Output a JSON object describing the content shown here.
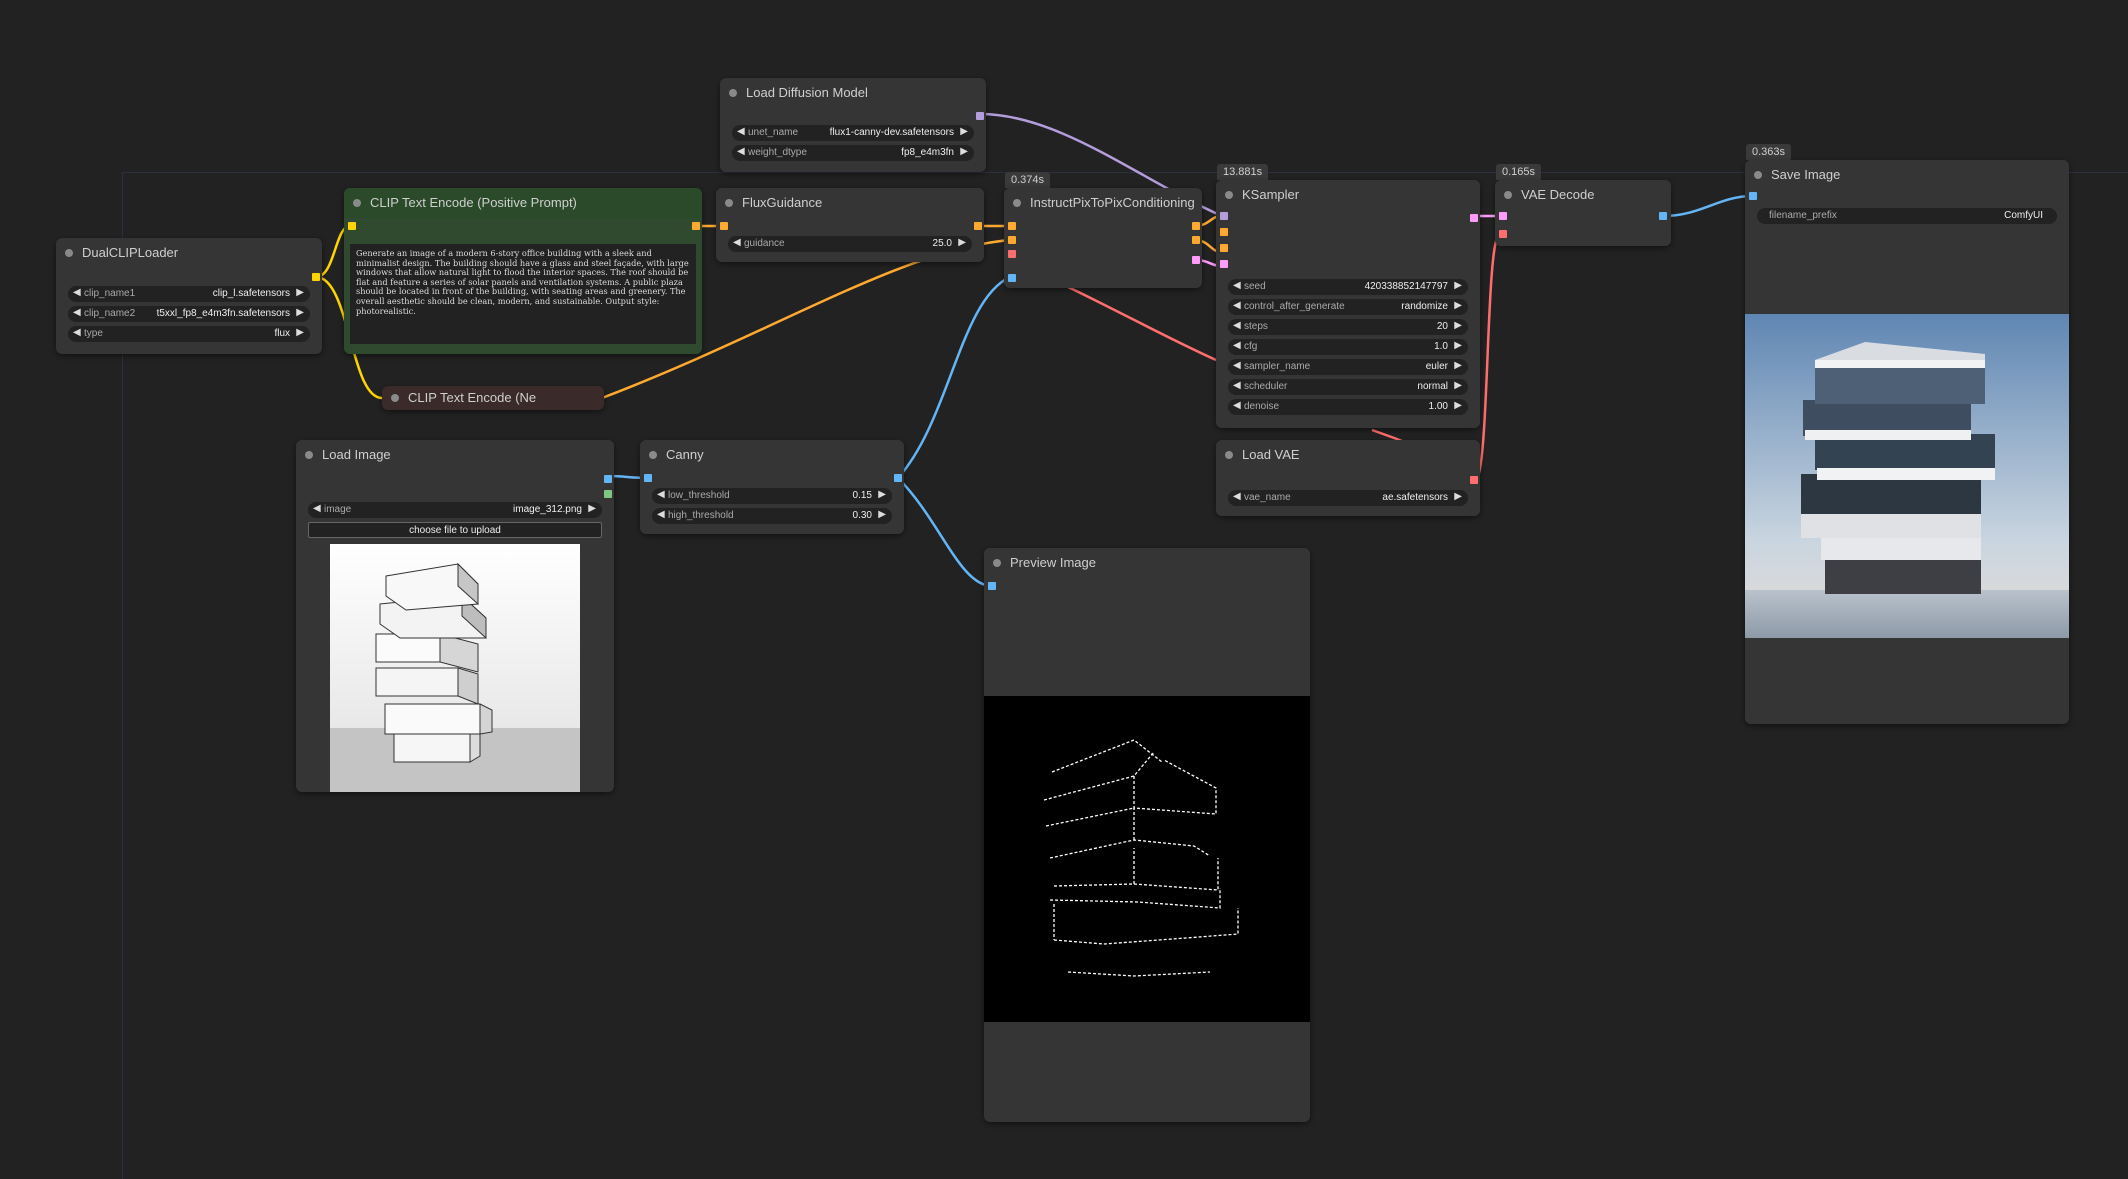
{
  "nodes": {
    "load_diffusion": {
      "title": "Load Diffusion Model",
      "widgets": [
        {
          "name": "unet_name",
          "value": "flux1-canny-dev.safetensors"
        },
        {
          "name": "weight_dtype",
          "value": "fp8_e4m3fn"
        }
      ]
    },
    "dual_clip": {
      "title": "DualCLIPLoader",
      "widgets": [
        {
          "name": "clip_name1",
          "value": "clip_l.safetensors"
        },
        {
          "name": "clip_name2",
          "value": "t5xxl_fp8_e4m3fn.safetensors"
        },
        {
          "name": "type",
          "value": "flux"
        }
      ]
    },
    "clip_pos": {
      "title": "CLIP Text Encode (Positive Prompt)",
      "prompt": "Generate an image of a modern 6-story office building with a sleek and minimalist design. The building should have a glass and steel façade, with large windows that allow natural light to flood the interior spaces. The roof should be flat and feature a series of solar panels and ventilation systems. A public plaza should be located in front of the building, with seating areas and greenery. The overall aesthetic should be clean, modern, and sustainable. Output style: photorealistic."
    },
    "clip_neg": {
      "title": "CLIP Text Encode (Ne"
    },
    "flux_guidance": {
      "title": "FluxGuidance",
      "widgets": [
        {
          "name": "guidance",
          "value": "25.0"
        }
      ]
    },
    "instruct_pix": {
      "title": "InstructPixToPixConditioning",
      "timing": "0.374s"
    },
    "ksampler": {
      "title": "KSampler",
      "timing": "13.881s",
      "widgets": [
        {
          "name": "seed",
          "value": "420338852147797"
        },
        {
          "name": "control_after_generate",
          "value": "randomize"
        },
        {
          "name": "steps",
          "value": "20"
        },
        {
          "name": "cfg",
          "value": "1.0"
        },
        {
          "name": "sampler_name",
          "value": "euler"
        },
        {
          "name": "scheduler",
          "value": "normal"
        },
        {
          "name": "denoise",
          "value": "1.00"
        }
      ]
    },
    "vae_decode": {
      "title": "VAE Decode",
      "timing": "0.165s"
    },
    "save_image": {
      "title": "Save Image",
      "timing": "0.363s",
      "widgets": [
        {
          "name": "filename_prefix",
          "value": "ComfyUI"
        }
      ]
    },
    "load_image": {
      "title": "Load Image",
      "widgets": [
        {
          "name": "image",
          "value": "image_312.png"
        }
      ],
      "upload_label": "choose file to upload"
    },
    "canny": {
      "title": "Canny",
      "widgets": [
        {
          "name": "low_threshold",
          "value": "0.15"
        },
        {
          "name": "high_threshold",
          "value": "0.30"
        }
      ]
    },
    "load_vae": {
      "title": "Load VAE",
      "widgets": [
        {
          "name": "vae_name",
          "value": "ae.safetensors"
        }
      ]
    },
    "preview_image": {
      "title": "Preview Image"
    }
  },
  "colors": {
    "canvas": "#222222",
    "node": "#353535",
    "clip_pos_node": "#2f4a2f",
    "clip_neg_node": "#3a2a2a",
    "link_model": "#b39ddb",
    "link_clip": "#ffd500",
    "link_conditioning": "#ffa931",
    "link_image": "#64b5f6",
    "link_latent": "#ff9cf9",
    "link_vae": "#ff6e6e"
  }
}
